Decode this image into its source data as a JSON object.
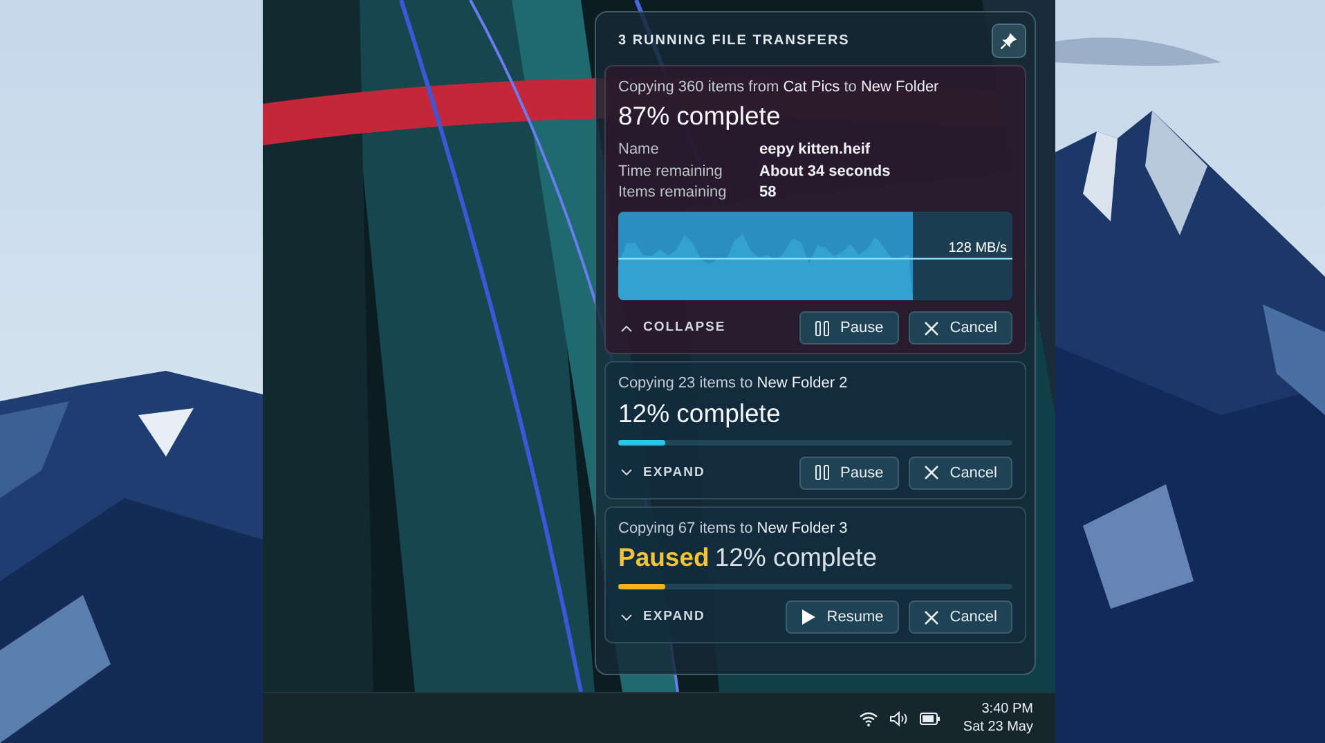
{
  "flyout": {
    "title": "3 RUNNING FILE TRANSFERS",
    "transfers": [
      {
        "kind": "detailed",
        "description": "Copying 360 items from **Cat Pics** to **New Folder**",
        "paused": false,
        "progress_text": "87% complete",
        "expanded": true,
        "details": [
          {
            "label": "Name",
            "value": "eepy kitten.heif"
          },
          {
            "label": "Time remaining",
            "value": "About 34 seconds"
          },
          {
            "label": "Items remaining",
            "value": "58"
          }
        ],
        "speed": "128 MB/s",
        "level": 0.74,
        "toggle_label": "COLLAPSE",
        "actions": [
          {
            "kind": "pause",
            "label": "Pause"
          },
          {
            "kind": "cancel",
            "label": "Cancel"
          }
        ]
      },
      {
        "kind": "compact",
        "description": "Copying 23 items to **New Folder 2**",
        "paused": false,
        "progress_text": "12% complete",
        "expanded": false,
        "level": 0.12,
        "toggle_label": "EXPAND",
        "actions": [
          {
            "kind": "pause",
            "label": "Pause"
          },
          {
            "kind": "cancel",
            "label": "Cancel"
          }
        ]
      },
      {
        "kind": "compact",
        "description": "Copying 67 items to **New Folder 3**",
        "paused": true,
        "status": "Paused",
        "progress_text": "12% complete",
        "expanded": false,
        "level": 0.12,
        "toggle_label": "EXPAND",
        "actions": [
          {
            "kind": "resume",
            "label": "Resume"
          },
          {
            "kind": "cancel",
            "label": "Cancel"
          }
        ]
      }
    ]
  },
  "taskbar": {
    "time": "3:40 PM",
    "date": "Sat 23 May"
  }
}
